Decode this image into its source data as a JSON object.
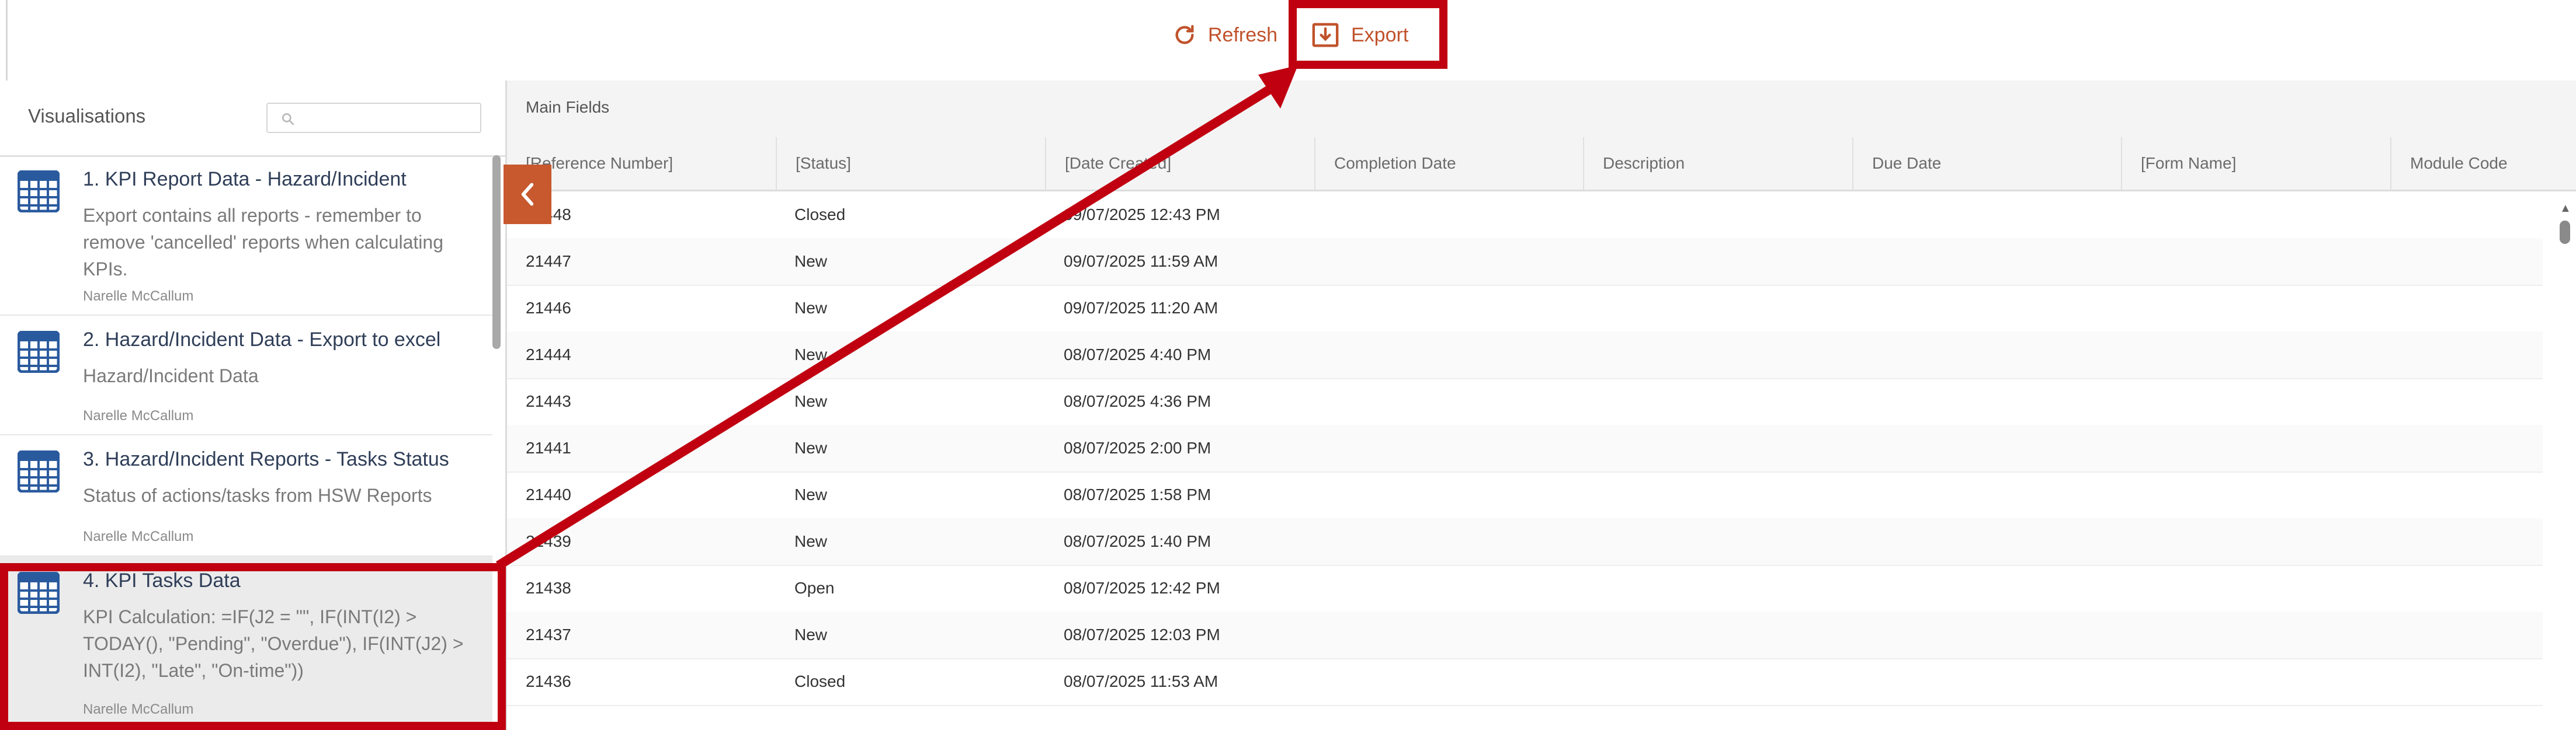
{
  "toolbar": {
    "refresh_label": "Refresh",
    "export_label": "Export",
    "accent_color": "#c0522b"
  },
  "sidebar": {
    "title": "Visualisations",
    "search_placeholder": "",
    "items": [
      {
        "title": "1. KPI Report Data - Hazard/Incident",
        "description": "Export contains all reports - remember to remove 'cancelled' reports when calculating KPIs.",
        "author": "Narelle McCallum",
        "icon": "table-icon"
      },
      {
        "title": "2. Hazard/Incident Data - Export to excel",
        "description": "Hazard/Incident Data",
        "author": "Narelle McCallum",
        "icon": "table-icon"
      },
      {
        "title": "3. Hazard/Incident Reports - Tasks Status",
        "description": "Status of actions/tasks from HSW Reports",
        "author": "Narelle McCallum",
        "icon": "table-icon"
      },
      {
        "title": "4. KPI Tasks Data",
        "description": "KPI Calculation: =IF(J2 = \"\", IF(INT(I2) > TODAY(), \"Pending\", \"Overdue\"), IF(INT(J2) > INT(I2), \"Late\", \"On-time\"))",
        "author": "Narelle McCallum",
        "icon": "table-icon",
        "selected": true
      }
    ]
  },
  "grid": {
    "section_label": "Main Fields",
    "columns": [
      "[Reference Number]",
      "[Status]",
      "[Date Created]",
      "Completion Date",
      "Description",
      "Due Date",
      "[Form Name]",
      "Module Code"
    ],
    "rows": [
      {
        "ref": "21448",
        "status": "Closed",
        "date": "09/07/2025 12:43 PM"
      },
      {
        "ref": "21447",
        "status": "New",
        "date": "09/07/2025 11:59 AM"
      },
      {
        "ref": "21446",
        "status": "New",
        "date": "09/07/2025 11:20 AM"
      },
      {
        "ref": "21444",
        "status": "New",
        "date": "08/07/2025 4:40 PM"
      },
      {
        "ref": "21443",
        "status": "New",
        "date": "08/07/2025 4:36 PM"
      },
      {
        "ref": "21441",
        "status": "New",
        "date": "08/07/2025 2:00 PM"
      },
      {
        "ref": "21440",
        "status": "New",
        "date": "08/07/2025 1:58 PM"
      },
      {
        "ref": "21439",
        "status": "New",
        "date": "08/07/2025 1:40 PM"
      },
      {
        "ref": "21438",
        "status": "Open",
        "date": "08/07/2025 12:42 PM"
      },
      {
        "ref": "21437",
        "status": "New",
        "date": "08/07/2025 12:03 PM"
      },
      {
        "ref": "21436",
        "status": "Closed",
        "date": "08/07/2025 11:53 AM"
      }
    ]
  },
  "annotation": {
    "color": "#c00010"
  }
}
